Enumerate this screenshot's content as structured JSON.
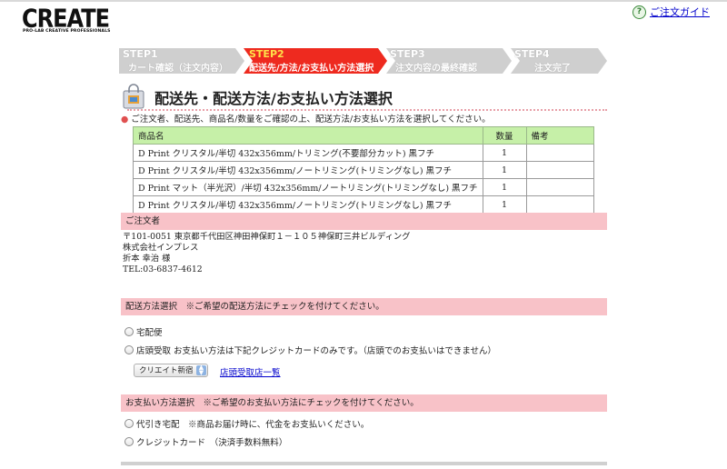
{
  "logo": {
    "word": "CREATE",
    "tagline": "PRO-LAB CREATIVE PROFESSIONALS"
  },
  "header": {
    "guide_icon": "?",
    "guide_link": "ご注文ガイド"
  },
  "steps": [
    {
      "num": "STEP1",
      "label": "カート確認（注文内容）",
      "state": "inactive"
    },
    {
      "num": "STEP2",
      "label": "配送先/方法/お支払い方法選択",
      "state": "active"
    },
    {
      "num": "STEP3",
      "label": "注文内容の最終確認",
      "state": "inactive"
    },
    {
      "num": "STEP4",
      "label": "注文完了",
      "state": "inactive"
    }
  ],
  "colors": {
    "active_step": "#ee2a1f",
    "inactive_step": "#cfcfcf",
    "table_header": "#c6f0a8",
    "section_bar": "#f8c2c8",
    "link": "#0000cc"
  },
  "page_title": "配送先・配送方法/お支払い方法選択",
  "intro": "ご注文者、配送先、商品名/数量をご確認の上、配送方法/お支払い方法を選択してください。",
  "items_table": {
    "headers": [
      "商品名",
      "数量",
      "備考"
    ],
    "rows": [
      {
        "name": "D Print クリスタル/半切 432x356mm/トリミング(不要部分カット) 黒フチ",
        "qty": "1",
        "note": ""
      },
      {
        "name": "D Print クリスタル/半切 432x356mm/ノートリミング(トリミングなし) 黒フチ",
        "qty": "1",
        "note": ""
      },
      {
        "name": "D Print マット（半光沢）/半切 432x356mm/ノートリミング(トリミングなし) 黒フチ",
        "qty": "1",
        "note": ""
      },
      {
        "name": "D Print クリスタル/半切 432x356mm/ノートリミング(トリミングなし) 黒フチ",
        "qty": "1",
        "note": ""
      }
    ]
  },
  "orderer": {
    "heading": "ご注文者",
    "lines": [
      "〒101-0051 東京都千代田区神田神保町１－１０５神保町三井ビルディング",
      "株式会社インプレス",
      "折本 幸治 様",
      "TEL:03-6837-4612"
    ]
  },
  "shipping": {
    "heading": "配送方法選択　※ご希望の配送方法にチェックを付けてください。",
    "options": [
      "宅配便",
      "店頭受取 お支払い方法は下記クレジットカードのみです。（店頭でのお支払いはできません）"
    ],
    "store_select": "クリエイト新宿",
    "store_link": "店頭受取店一覧"
  },
  "payment": {
    "heading": "お支払い方法選択　※ご希望のお支払い方法にチェックを付けてください。",
    "options": [
      "代引き宅配　※商品お届け時に、代金をお支払いください。",
      "クレジットカード　（決済手数料無料）"
    ]
  }
}
